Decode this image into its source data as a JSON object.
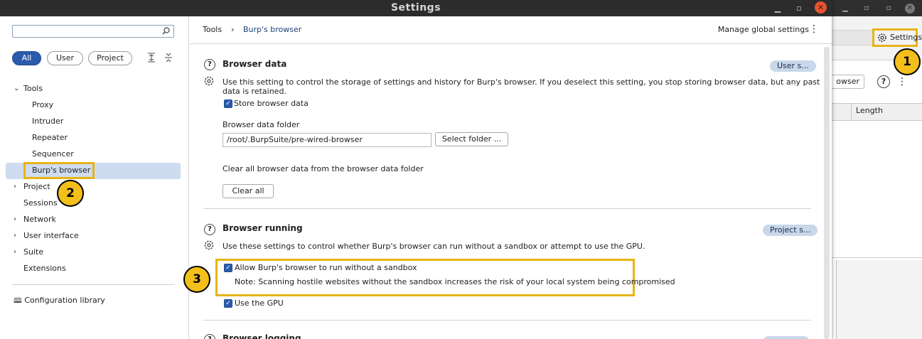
{
  "dialog": {
    "title": "Settings",
    "controls": {
      "minimize": "▁",
      "restore": "▫",
      "close": "✕"
    }
  },
  "background_app": {
    "settings_button": "Settings",
    "browser_button": "owser",
    "help": "?",
    "column_length": "Length"
  },
  "callouts": [
    "1",
    "2",
    "3"
  ],
  "left_pane": {
    "search_placeholder": "",
    "filters": [
      {
        "label": "All",
        "active": true
      },
      {
        "label": "User",
        "active": false
      },
      {
        "label": "Project",
        "active": false
      }
    ],
    "tree": [
      {
        "label": "Tools",
        "expanded": true,
        "children": [
          "Proxy",
          "Intruder",
          "Repeater",
          "Sequencer",
          "Burp's browser"
        ]
      },
      {
        "label": "Project",
        "expandable": true
      },
      {
        "label": "Sessions"
      },
      {
        "label": "Network",
        "expandable": true
      },
      {
        "label": "User interface",
        "expandable": true
      },
      {
        "label": "Suite",
        "expandable": true
      },
      {
        "label": "Extensions"
      }
    ],
    "selected": "Burp's browser",
    "config_library": "Configuration library"
  },
  "header": {
    "breadcrumb": [
      "Tools",
      "Burp's browser"
    ],
    "separator": "›",
    "manage_global": "Manage global settings"
  },
  "browser_data": {
    "title": "Browser data",
    "scope_tag": "User s...",
    "description": "Use this setting to control the storage of settings and history for Burp's browser. If you deselect this setting, you stop storing browser data, but any past data is retained.",
    "store_label": "Store browser data",
    "store_checked": true,
    "folder_label": "Browser data folder",
    "folder_value": "/root/.BurpSuite/pre-wired-browser",
    "select_folder": "Select folder ...",
    "clear_desc": "Clear all browser data from the browser data folder",
    "clear_all": "Clear all"
  },
  "browser_running": {
    "title": "Browser running",
    "scope_tag": "Project s...",
    "description": "Use these settings to control whether Burp's browser can run without a sandbox or attempt to use the GPU.",
    "sandbox_label": "Allow Burp's browser to run without a sandbox",
    "sandbox_checked": true,
    "sandbox_note": "Note: Scanning hostile websites without the sandbox increases the risk of your local system being compromised",
    "gpu_label": "Use the GPU",
    "gpu_checked": true
  },
  "browser_logging": {
    "title": "Browser logging"
  },
  "colors": {
    "accent": "#2b5bab",
    "highlight": "#e7b416",
    "selection": "#cfdcef",
    "tag": "#c9d7ea"
  }
}
